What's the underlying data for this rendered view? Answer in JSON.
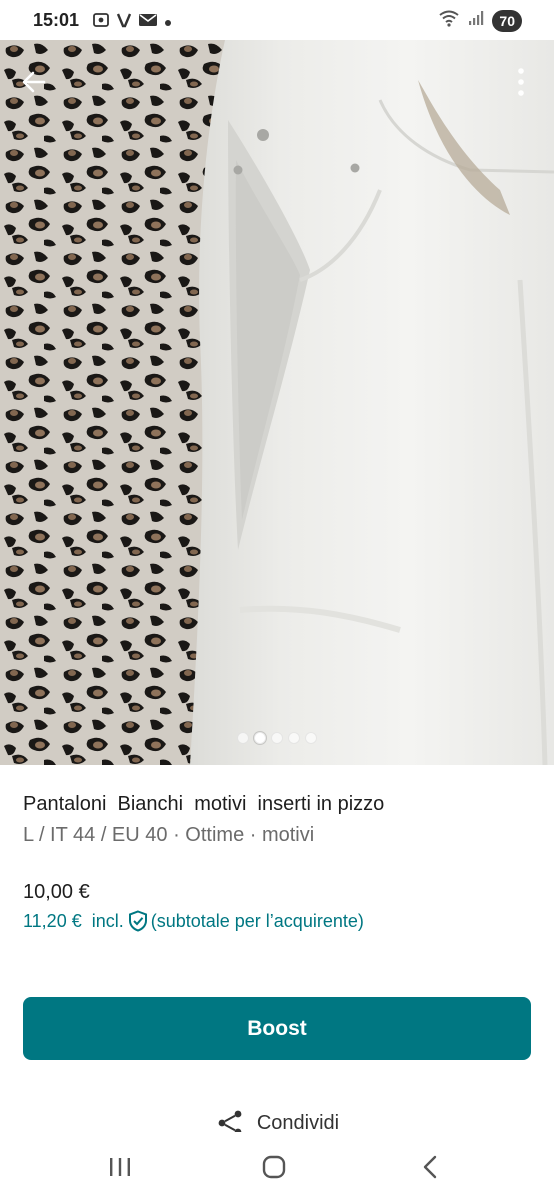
{
  "status_bar": {
    "time": "15:01",
    "battery": "70",
    "icons_left": [
      "screenshot-icon",
      "v-icon",
      "mail-icon",
      "dot-icon"
    ],
    "icons_right": [
      "wifi-icon",
      "signal-icon"
    ]
  },
  "gallery": {
    "image_subject": "white trousers with lace inserts on leopard print fabric",
    "dots_count": 5,
    "active_dot_index": 1
  },
  "item": {
    "title": "Pantaloni  Bianchi  motivi  inserti in pizzo",
    "subtitle": "L / IT 44 / EU 40 · Ottime · motivi",
    "price": "10,00 €",
    "price_incl": "11,20 €  incl.",
    "price_note": "(subtotale per l’acquirente)"
  },
  "actions": {
    "boost_label": "Boost",
    "share_label": "Condividi"
  },
  "colors": {
    "accent": "#007782",
    "text": "#1e1e1e",
    "muted": "#6b6b6b"
  }
}
